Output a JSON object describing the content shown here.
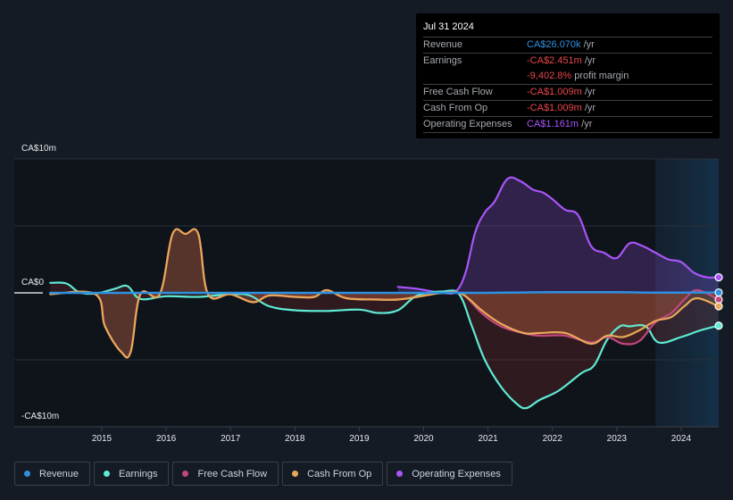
{
  "tooltip": {
    "date": "Jul 31 2024",
    "rows": [
      {
        "label": "Revenue",
        "value": "CA$26.070k",
        "suffix": " /yr",
        "color": "#2e90e0"
      },
      {
        "label": "Earnings",
        "value": "-CA$2.451m",
        "suffix": " /yr",
        "color": "#e8474a"
      },
      {
        "label": "",
        "value": "-9,402.8%",
        "suffix": " profit margin",
        "color": "#e8474a"
      },
      {
        "label": "Free Cash Flow",
        "value": "-CA$1.009m",
        "suffix": " /yr",
        "color": "#e8474a"
      },
      {
        "label": "Cash From Op",
        "value": "-CA$1.009m",
        "suffix": " /yr",
        "color": "#e8474a"
      },
      {
        "label": "Operating Expenses",
        "value": "CA$1.161m",
        "suffix": " /yr",
        "color": "#a855f7"
      }
    ]
  },
  "legend": [
    {
      "label": "Revenue",
      "color": "#2e90e0"
    },
    {
      "label": "Earnings",
      "color": "#5eead4"
    },
    {
      "label": "Free Cash Flow",
      "color": "#c2477f"
    },
    {
      "label": "Cash From Op",
      "color": "#e8a85a"
    },
    {
      "label": "Operating Expenses",
      "color": "#a855f7"
    }
  ],
  "chart_data": {
    "type": "line",
    "title": "",
    "xlabel": "",
    "ylabel": "",
    "y_tick_labels": [
      "CA$10m",
      "CA$0",
      "-CA$10m"
    ],
    "y_ticks": [
      10,
      0,
      -10
    ],
    "ylim": [
      -10,
      10
    ],
    "x_tick_labels": [
      "2015",
      "2016",
      "2017",
      "2018",
      "2019",
      "2020",
      "2021",
      "2022",
      "2023",
      "2024"
    ],
    "x_ticks": [
      2015,
      2016,
      2017,
      2018,
      2019,
      2020,
      2021,
      2022,
      2023,
      2024
    ],
    "xlim": [
      2014.1,
      2024.6
    ],
    "forecast_shade_start": 2023.6,
    "units": "CA$ millions",
    "grid": true,
    "series": [
      {
        "name": "Revenue",
        "color": "#2e90e0",
        "x": [
          2014.2,
          2015,
          2016,
          2017,
          2018,
          2019,
          2020,
          2020.5,
          2021,
          2021.5,
          2022,
          2022.5,
          2023,
          2023.5,
          2024,
          2024.58
        ],
        "values": [
          0,
          0,
          0,
          0,
          0,
          0,
          0,
          0,
          0,
          0.03,
          0.05,
          0.05,
          0.05,
          0.02,
          0.02,
          0.03
        ]
      },
      {
        "name": "Earnings",
        "color": "#5eead4",
        "x": [
          2014.2,
          2014.45,
          2014.65,
          2014.9,
          2015.2,
          2015.4,
          2015.6,
          2016,
          2016.5,
          2017,
          2017.3,
          2017.6,
          2018,
          2018.5,
          2019,
          2019.3,
          2019.6,
          2019.9,
          2020.3,
          2020.55,
          2020.75,
          2020.95,
          2021.2,
          2021.45,
          2021.6,
          2021.8,
          2022.1,
          2022.45,
          2022.65,
          2022.85,
          2023.05,
          2023.2,
          2023.45,
          2023.65,
          2024,
          2024.3,
          2024.58
        ],
        "values": [
          0.75,
          0.7,
          0.05,
          -0.05,
          0.3,
          0.5,
          -0.45,
          -0.25,
          -0.3,
          -0.1,
          -0.2,
          -1.0,
          -1.3,
          -1.35,
          -1.25,
          -1.5,
          -1.3,
          -0.2,
          0.1,
          -0.1,
          -2.5,
          -5.0,
          -7.0,
          -8.3,
          -8.6,
          -8.0,
          -7.3,
          -6.0,
          -5.4,
          -3.5,
          -2.5,
          -2.5,
          -2.5,
          -3.7,
          -3.3,
          -2.8,
          -2.45
        ]
      },
      {
        "name": "Free Cash Flow",
        "color": "#c2477f",
        "x": [
          2014.2,
          2014.9,
          2015.05,
          2015.3,
          2015.45,
          2015.6,
          2015.9,
          2016.1,
          2016.3,
          2016.5,
          2016.65,
          2017,
          2017.35,
          2017.6,
          2018,
          2018.3,
          2018.5,
          2018.8,
          2019.3,
          2019.6,
          2019.9,
          2020.3,
          2020.6,
          2020.9,
          2021.2,
          2021.55,
          2021.8,
          2022.2,
          2022.6,
          2022.85,
          2023.1,
          2023.35,
          2023.6,
          2023.85,
          2024.05,
          2024.25,
          2024.58
        ],
        "values": [
          -0.1,
          -0.1,
          -2.5,
          -4.4,
          -4.4,
          -0.1,
          -0.1,
          4.4,
          4.4,
          4.4,
          -0.1,
          -0.1,
          -0.7,
          -0.2,
          -0.3,
          -0.3,
          0.2,
          -0.4,
          -0.5,
          -0.5,
          -0.3,
          0,
          -0.1,
          -1.5,
          -2.5,
          -3.0,
          -3.2,
          -3.2,
          -3.7,
          -3.3,
          -3.8,
          -3.6,
          -2.2,
          -1.5,
          -0.5,
          0.2,
          -0.5
        ]
      },
      {
        "name": "Cash From Op",
        "color": "#e8a85a",
        "x": [
          2014.2,
          2014.9,
          2015.05,
          2015.3,
          2015.45,
          2015.6,
          2015.9,
          2016.1,
          2016.3,
          2016.5,
          2016.65,
          2017,
          2017.35,
          2017.6,
          2018,
          2018.3,
          2018.5,
          2018.8,
          2019.3,
          2019.6,
          2019.9,
          2020.3,
          2020.6,
          2020.9,
          2021.2,
          2021.55,
          2021.8,
          2022.2,
          2022.6,
          2022.85,
          2023.1,
          2023.35,
          2023.6,
          2023.85,
          2024.05,
          2024.25,
          2024.58
        ],
        "values": [
          -0.1,
          -0.1,
          -2.5,
          -4.4,
          -4.4,
          -0.1,
          -0.1,
          4.4,
          4.4,
          4.4,
          -0.1,
          -0.1,
          -0.7,
          -0.2,
          -0.3,
          -0.3,
          0.2,
          -0.4,
          -0.5,
          -0.5,
          -0.3,
          0,
          -0.1,
          -1.3,
          -2.3,
          -3.0,
          -3.0,
          -3.0,
          -3.8,
          -3.2,
          -3.3,
          -2.8,
          -2.1,
          -1.8,
          -1.0,
          -0.4,
          -1.0
        ]
      },
      {
        "name": "Operating Expenses",
        "color": "#a855f7",
        "x": [
          2019.6,
          2019.9,
          2020.3,
          2020.5,
          2020.65,
          2020.8,
          2020.95,
          2021.1,
          2021.3,
          2021.5,
          2021.7,
          2021.85,
          2022.0,
          2022.2,
          2022.4,
          2022.6,
          2022.8,
          2023.0,
          2023.2,
          2023.4,
          2023.6,
          2023.8,
          2024.0,
          2024.2,
          2024.4,
          2024.58
        ],
        "values": [
          0.45,
          0.3,
          0.0,
          0.1,
          1.5,
          4.5,
          6.0,
          6.8,
          8.5,
          8.35,
          7.7,
          7.5,
          7.0,
          6.2,
          5.8,
          3.5,
          3.0,
          2.6,
          3.7,
          3.5,
          3.0,
          2.5,
          2.3,
          1.5,
          1.16,
          1.16
        ]
      }
    ]
  }
}
